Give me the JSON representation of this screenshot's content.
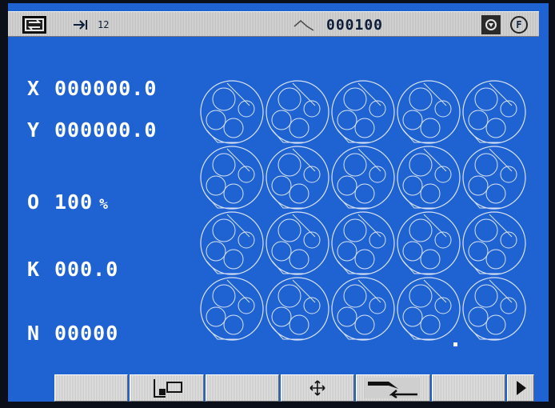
{
  "topbar": {
    "program_number": "12",
    "counter": "000100"
  },
  "readouts": [
    {
      "label": "X",
      "value": "000000.0"
    },
    {
      "label": "Y",
      "value": "000000.0"
    },
    {
      "label": "O",
      "value": "100",
      "unit": "%"
    },
    {
      "label": "K",
      "value": "000.0"
    },
    {
      "label": "N",
      "value": "00000"
    }
  ],
  "status_icons": {
    "cycle": "cycle-icon",
    "program": "program-arrow-icon",
    "wave": "wave-icon",
    "shield": "shield-icon",
    "function": "F"
  },
  "toolbar": {
    "buttons": [
      {
        "name": "softkey-1",
        "icon": ""
      },
      {
        "name": "softkey-2",
        "icon": "step-frame-icon"
      },
      {
        "name": "softkey-3",
        "icon": ""
      },
      {
        "name": "softkey-4",
        "icon": "move-arrows-icon"
      },
      {
        "name": "softkey-5",
        "icon": "cut-arrow-icon"
      },
      {
        "name": "softkey-6",
        "icon": ""
      },
      {
        "name": "softkey-7",
        "icon": "play-next-icon"
      }
    ]
  }
}
